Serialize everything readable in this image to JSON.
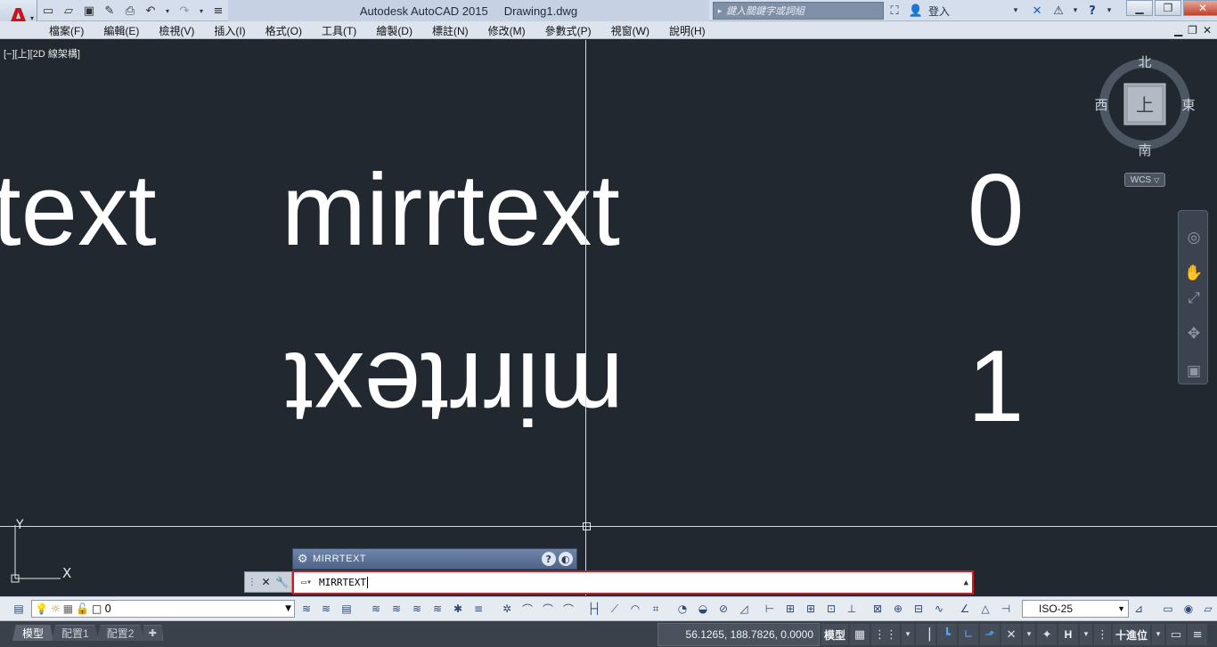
{
  "app": {
    "name": "Autodesk AutoCAD 2015",
    "document": "Drawing1.dwg"
  },
  "titlebar": {
    "search_placeholder": "鍵入關鍵字或詞組",
    "signin_label": "登入"
  },
  "menus": [
    "檔案(F)",
    "編輯(E)",
    "檢視(V)",
    "插入(I)",
    "格式(O)",
    "工具(T)",
    "繪製(D)",
    "標註(N)",
    "修改(M)",
    "參數式(P)",
    "視窗(W)",
    "說明(H)"
  ],
  "viewport": {
    "label": "[−][上][2D 線架構]",
    "texts": {
      "left_partial": "rtext",
      "mirrtext": "mirrtext",
      "zero": "0",
      "mirrored": "mirrtext",
      "one": "1"
    },
    "ucs": {
      "x": "X",
      "y": "Y"
    }
  },
  "viewcube": {
    "north": "北",
    "south": "南",
    "east": "東",
    "west": "西",
    "top": "上",
    "wcs": "WCS"
  },
  "command": {
    "history_title": "MIRRTEXT",
    "input": "MIRRTEXT"
  },
  "layer_toolbar": {
    "current_layer": "0",
    "dim_style": "ISO-25"
  },
  "statusbar": {
    "tabs": [
      "模型",
      "配置1",
      "配置2"
    ],
    "coords": "56.1265, 188.7826, 0.0000",
    "model_label": "模型",
    "annot_scale": "H",
    "units_label": "十進位"
  },
  "colors": {
    "viewport_bg": "#212830",
    "cmd_border": "#e0141e",
    "titlebar_bg": "#d4deec"
  }
}
